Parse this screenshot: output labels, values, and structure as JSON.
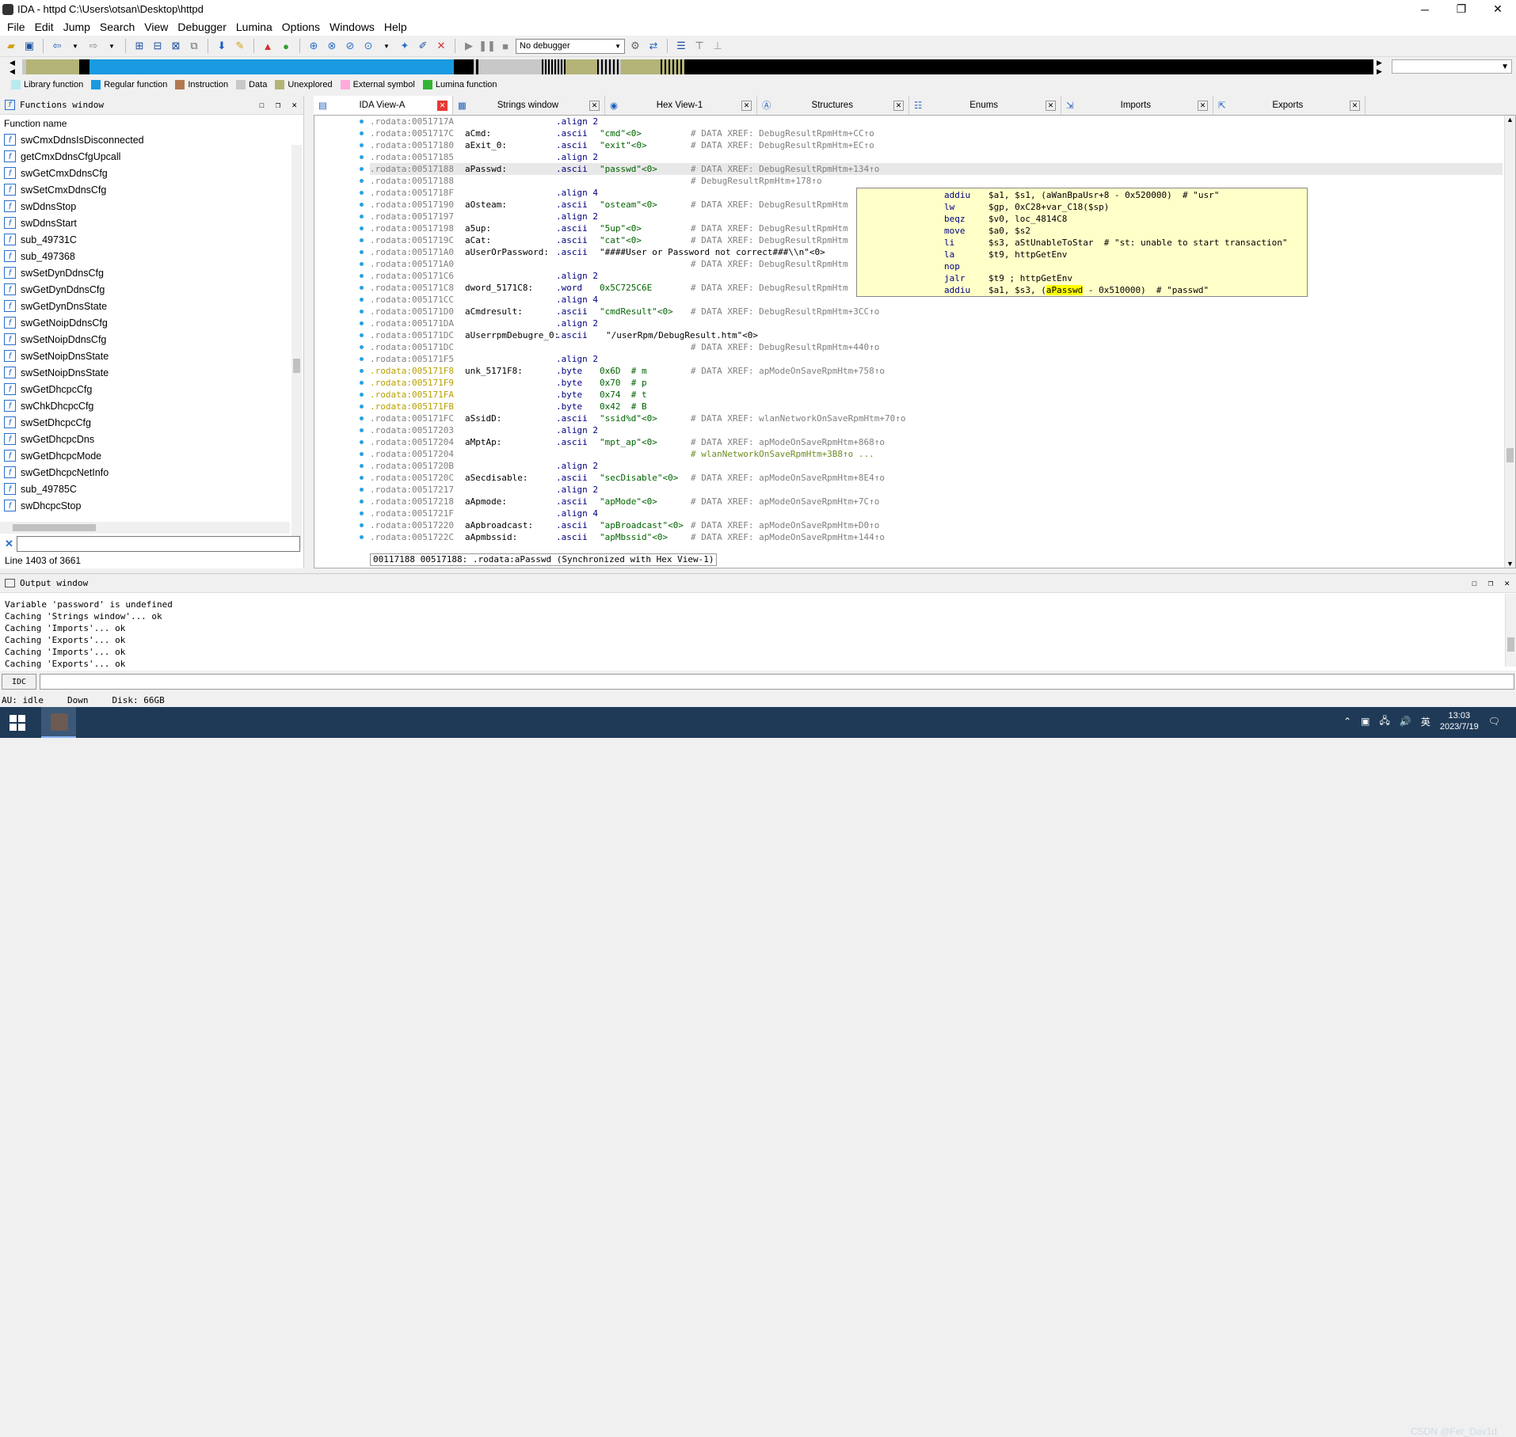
{
  "window": {
    "title": "IDA - httpd C:\\Users\\otsan\\Desktop\\httpd",
    "minimize_label": "─",
    "maximize_label": "❐",
    "close_label": "✕"
  },
  "menu": [
    "File",
    "Edit",
    "Jump",
    "Search",
    "View",
    "Debugger",
    "Lumina",
    "Options",
    "Windows",
    "Help"
  ],
  "toolbar": {
    "debugger_select": "No debugger"
  },
  "legend": [
    {
      "label": "Library function",
      "color": "#b8eaf0"
    },
    {
      "label": "Regular function",
      "color": "#1a9ae0"
    },
    {
      "label": "Instruction",
      "color": "#b47850"
    },
    {
      "label": "Data",
      "color": "#c8c8c8"
    },
    {
      "label": "Unexplored",
      "color": "#b4b478"
    },
    {
      "label": "External symbol",
      "color": "#ffaadc"
    },
    {
      "label": "Lumina function",
      "color": "#32b432"
    }
  ],
  "functions_window": {
    "title": "Functions window",
    "column": "Function name",
    "items": [
      "swCmxDdnsIsDisconnected",
      "getCmxDdnsCfgUpcall",
      "swGetCmxDdnsCfg",
      "swSetCmxDdnsCfg",
      "swDdnsStop",
      "swDdnsStart",
      "sub_49731C",
      "sub_497368",
      "swSetDynDdnsCfg",
      "swGetDynDdnsCfg",
      "swGetDynDnsState",
      "swGetNoipDdnsCfg",
      "swSetNoipDdnsCfg",
      "swSetNoipDnsState",
      "swSetNoipDnsState",
      "swGetDhcpcCfg",
      "swChkDhcpcCfg",
      "swSetDhcpcCfg",
      "swGetDhcpcDns",
      "swGetDhcpcMode",
      "swGetDhcpcNetInfo",
      "sub_49785C",
      "swDhcpcStop"
    ],
    "status": "Line 1403 of 3661"
  },
  "tabs": [
    {
      "label": "IDA View-A",
      "active": true
    },
    {
      "label": "Strings window",
      "active": false
    },
    {
      "label": "Hex View-1",
      "active": false
    },
    {
      "label": "Structures",
      "active": false
    },
    {
      "label": "Enums",
      "active": false
    },
    {
      "label": "Imports",
      "active": false
    },
    {
      "label": "Exports",
      "active": false
    }
  ],
  "disasm": [
    {
      "addr": ".rodata:0051717A",
      "label": "",
      "ins": ".align 2",
      "opd": "",
      "cmt": ""
    },
    {
      "addr": ".rodata:0051717C",
      "label": "aCmd:",
      "ins": ".ascii",
      "opd": "\"cmd\"<0>",
      "cmt": "# DATA XREF: DebugResultRpmHtm+CC↑o"
    },
    {
      "addr": ".rodata:00517180",
      "label": "aExit_0:",
      "ins": ".ascii",
      "opd": "\"exit\"<0>",
      "cmt": "# DATA XREF: DebugResultRpmHtm+EC↑o"
    },
    {
      "addr": ".rodata:00517185",
      "label": "",
      "ins": ".align 2",
      "opd": "",
      "cmt": ""
    },
    {
      "addr": ".rodata:00517188",
      "label": "aPasswd:",
      "ins": ".ascii",
      "opd": "\"passwd\"<0>",
      "cmt": "# DATA XREF: DebugResultRpmHtm+134↑o",
      "highlight": true
    },
    {
      "addr": ".rodata:00517188",
      "label": "",
      "ins": "",
      "opd": "",
      "cmt": "# DebugResultRpmHtm+178↑o"
    },
    {
      "addr": ".rodata:0051718F",
      "label": "",
      "ins": ".align 4",
      "opd": "",
      "cmt": ""
    },
    {
      "addr": ".rodata:00517190",
      "label": "aOsteam:",
      "ins": ".ascii",
      "opd": "\"osteam\"<0>",
      "cmt": "# DATA XREF: DebugResultRpmHtm"
    },
    {
      "addr": ".rodata:00517197",
      "label": "",
      "ins": ".align 2",
      "opd": "",
      "cmt": ""
    },
    {
      "addr": ".rodata:00517198",
      "label": "a5up:",
      "ins": ".ascii",
      "opd": "\"5up\"<0>",
      "cmt": "# DATA XREF: DebugResultRpmHtm"
    },
    {
      "addr": ".rodata:0051719C",
      "label": "aCat:",
      "ins": ".ascii",
      "opd": "\"cat\"<0>",
      "cmt": "# DATA XREF: DebugResultRpmHtm"
    },
    {
      "addr": ".rodata:005171A0",
      "label": "aUserOrPassword:",
      "ins": ".ascii",
      "opd": "\"####User or Password not correct###\\\\n\"<0>",
      "cmt": "",
      "long": true
    },
    {
      "addr": ".rodata:005171A0",
      "label": "",
      "ins": "",
      "opd": "",
      "cmt": "# DATA XREF: DebugResultRpmHtm"
    },
    {
      "addr": ".rodata:005171C6",
      "label": "",
      "ins": ".align 2",
      "opd": "",
      "cmt": ""
    },
    {
      "addr": ".rodata:005171C8",
      "label": "dword_5171C8:",
      "ins": ".word",
      "opd": "0x5C725C6E",
      "cmt": "# DATA XREF: DebugResultRpmHtm"
    },
    {
      "addr": ".rodata:005171CC",
      "label": "",
      "ins": ".align 4",
      "opd": "",
      "cmt": ""
    },
    {
      "addr": ".rodata:005171D0",
      "label": "aCmdresult:",
      "ins": ".ascii",
      "opd": "\"cmdResult\"<0>",
      "cmt": "# DATA XREF: DebugResultRpmHtm+3CC↑o"
    },
    {
      "addr": ".rodata:005171DA",
      "label": "",
      "ins": ".align 2",
      "opd": "",
      "cmt": ""
    },
    {
      "addr": ".rodata:005171DC",
      "label": "aUserrpmDebugre_0:",
      "ins": ".ascii",
      "opd": "\"/userRpm/DebugResult.htm\"<0>",
      "cmt": "",
      "long": true
    },
    {
      "addr": ".rodata:005171DC",
      "label": "",
      "ins": "",
      "opd": "",
      "cmt": "# DATA XREF: DebugResultRpmHtm+440↑o"
    },
    {
      "addr": ".rodata:005171F5",
      "label": "",
      "ins": ".align 2",
      "opd": "",
      "cmt": ""
    },
    {
      "addr": ".rodata:005171F8",
      "label": "unk_5171F8:",
      "ins": ".byte",
      "opd": "0x6D  # m",
      "cmt": "# DATA XREF: apModeOnSaveRpmHtm+758↑o",
      "yellow": true
    },
    {
      "addr": ".rodata:005171F9",
      "label": "",
      "ins": ".byte",
      "opd": "0x70  # p",
      "cmt": "",
      "yellow": true
    },
    {
      "addr": ".rodata:005171FA",
      "label": "",
      "ins": ".byte",
      "opd": "0x74  # t",
      "cmt": "",
      "yellow": true
    },
    {
      "addr": ".rodata:005171FB",
      "label": "",
      "ins": ".byte",
      "opd": "0x42  # B",
      "cmt": "",
      "yellow": true
    },
    {
      "addr": ".rodata:005171FC",
      "label": "aSsidD:",
      "ins": ".ascii",
      "opd": "\"ssid%d\"<0>",
      "cmt": "# DATA XREF: wlanNetworkOnSaveRpmHtm+70↑o"
    },
    {
      "addr": ".rodata:00517203",
      "label": "",
      "ins": ".align 2",
      "opd": "",
      "cmt": ""
    },
    {
      "addr": ".rodata:00517204",
      "label": "aMptAp:",
      "ins": ".ascii",
      "opd": "\"mpt_ap\"<0>",
      "cmt": "# DATA XREF: apModeOnSaveRpmHtm+868↑o"
    },
    {
      "addr": ".rodata:00517204",
      "label": "",
      "ins": "",
      "opd": "",
      "cmt": "# wlanNetworkOnSaveRpmHtm+3B8↑o ...",
      "green": true
    },
    {
      "addr": ".rodata:0051720B",
      "label": "",
      "ins": ".align 2",
      "opd": "",
      "cmt": ""
    },
    {
      "addr": ".rodata:0051720C",
      "label": "aSecdisable:",
      "ins": ".ascii",
      "opd": "\"secDisable\"<0>",
      "cmt": "# DATA XREF: apModeOnSaveRpmHtm+8E4↑o"
    },
    {
      "addr": ".rodata:00517217",
      "label": "",
      "ins": ".align 2",
      "opd": "",
      "cmt": ""
    },
    {
      "addr": ".rodata:00517218",
      "label": "aApmode:",
      "ins": ".ascii",
      "opd": "\"apMode\"<0>",
      "cmt": "# DATA XREF: apModeOnSaveRpmHtm+7C↑o"
    },
    {
      "addr": ".rodata:0051721F",
      "label": "",
      "ins": ".align 4",
      "opd": "",
      "cmt": ""
    },
    {
      "addr": ".rodata:00517220",
      "label": "aApbroadcast:",
      "ins": ".ascii",
      "opd": "\"apBroadcast\"<0>",
      "cmt": "# DATA XREF: apModeOnSaveRpmHtm+D0↑o"
    },
    {
      "addr": ".rodata:0051722C",
      "label": "aApmbssid:",
      "ins": ".ascii",
      "opd": "\"apMbssid\"<0>",
      "cmt": "# DATA XREF: apModeOnSaveRpmHtm+144↑o"
    }
  ],
  "sync_status": "00117188 00517188: .rodata:aPasswd (Synchronized with Hex View-1)",
  "hint": [
    {
      "ins": "addiu",
      "opd": "$a1, $s1, (aWanBpaUsr+8 - 0x520000)  # \"usr\""
    },
    {
      "ins": "lw",
      "opd": "$gp, 0xC28+var_C18($sp)"
    },
    {
      "ins": "beqz",
      "opd": "$v0, loc_4814C8"
    },
    {
      "ins": "move",
      "opd": "$a0, $s2"
    },
    {
      "ins": "li",
      "opd": "$s3, aStUnableToStar  # \"st: unable to start transaction\""
    },
    {
      "ins": "la",
      "opd": "$t9, httpGetEnv"
    },
    {
      "ins": "nop",
      "opd": ""
    },
    {
      "ins": "jalr",
      "opd": "$t9 ; httpGetEnv"
    },
    {
      "ins": "addiu",
      "opd_pre": "$a1, $s3, (",
      "opd_mark": "aPasswd",
      "opd_post": " - 0x510000)  # \"passwd\""
    }
  ],
  "output_window": {
    "title": "Output window",
    "lines": [
      "Variable 'password' is undefined",
      "Caching 'Strings window'... ok",
      "Caching 'Imports'... ok",
      "Caching 'Exports'... ok",
      "Caching 'Imports'... ok",
      "Caching 'Exports'... ok"
    ]
  },
  "idc_label": "IDC",
  "statusbar": {
    "au": "AU:",
    "state": "idle",
    "dir": "Down",
    "disk": "Disk: 66GB"
  },
  "taskbar": {
    "ime": "英",
    "time": "13:03",
    "date": "2023/7/19",
    "watermark": "CSDN @Fer_Dav1d"
  }
}
